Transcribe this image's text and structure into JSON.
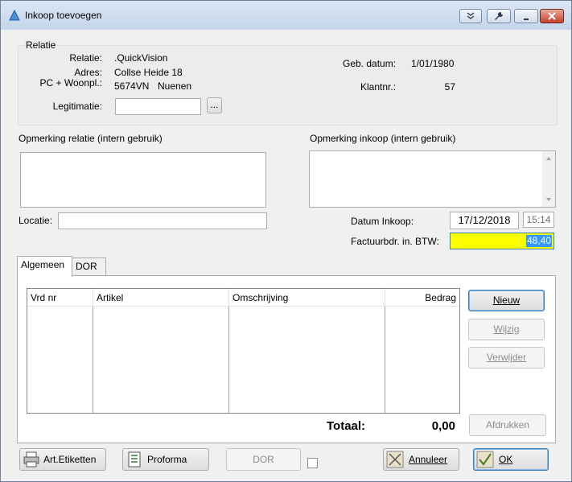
{
  "window": {
    "title": "Inkoop toevoegen"
  },
  "relatie": {
    "group_label": "Relatie",
    "relatie_label": "Relatie:",
    "relatie_value": ".QuickVision",
    "adres_label": "Adres:",
    "adres_value": "Collse Heide 18",
    "pc_label": "PC + Woonpl.:",
    "pc_value": "5674VN",
    "woonplaats_value": "Nuenen",
    "legitimatie_label": "Legitimatie:",
    "legitimatie_value": "",
    "browse_label": "...",
    "geb_label": "Geb. datum:",
    "geb_value": "1/01/1980",
    "klantnr_label": "Klantnr.:",
    "klantnr_value": "57"
  },
  "opmerking_relatie": {
    "label": "Opmerking relatie (intern gebruik)",
    "value": ""
  },
  "opmerking_inkoop": {
    "label": "Opmerking inkoop (intern gebruik)",
    "value": ""
  },
  "locatie": {
    "label": "Locatie:",
    "value": ""
  },
  "datum": {
    "label": "Datum Inkoop:",
    "date": "17/12/2018",
    "time": "15:14"
  },
  "factuur": {
    "label": "Factuurbdr. in. BTW:",
    "value": "48,40",
    "highlight": "#ffff00",
    "selection": "#3399ff"
  },
  "tabs": [
    {
      "label": "Algemeen"
    },
    {
      "label": "DOR"
    }
  ],
  "grid": {
    "columns": [
      {
        "label": "Vrd nr"
      },
      {
        "label": "Artikel"
      },
      {
        "label": "Omschrijving"
      },
      {
        "label": "Bedrag"
      }
    ]
  },
  "side_buttons": {
    "nieuw": "Nieuw",
    "wijzig": "Wijzig",
    "verwijder": "Verwijder",
    "afdrukken": "Afdrukken"
  },
  "totaal": {
    "label": "Totaal:",
    "value": "0,00"
  },
  "bottom": {
    "etiketten": "Art.Etiketten",
    "proforma": "Proforma",
    "dor": "DOR",
    "annuleer": "Annuleer",
    "ok": "OK"
  }
}
